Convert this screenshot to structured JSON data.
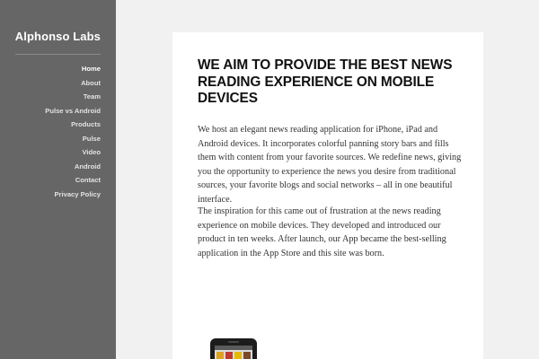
{
  "site": {
    "title": "Alphonso Labs"
  },
  "nav": {
    "items": [
      {
        "label": "Home",
        "active": true
      },
      {
        "label": "About",
        "active": false
      },
      {
        "label": "Team",
        "active": false
      },
      {
        "label": "Pulse vs Android",
        "active": false
      },
      {
        "label": "Products",
        "active": false
      },
      {
        "label": "Pulse",
        "active": false
      },
      {
        "label": "Video",
        "active": false
      },
      {
        "label": "Android",
        "active": false
      },
      {
        "label": "Contact",
        "active": false
      },
      {
        "label": "Privacy Policy",
        "active": false
      }
    ]
  },
  "main": {
    "headline": "WE AIM TO PROVIDE THE BEST NEWS READING EXPERIENCE ON MOBILE DEVICES",
    "paragraphs": [
      "We host an elegant news reading application for iPhone, iPad and Android devices. It incorporates colorful panning story bars and fills them with content from your favorite sources. We redefine news, giving you the opportunity to experience the news you desire from traditional sources, your favorite blogs and social networks – all in one beautiful interface.",
      "The inspiration for this came out of frustration at the news reading experience on mobile devices. They developed and introduced our product in ten weeks. After launch, our App became the best-selling application in the App Store and this site was born."
    ]
  },
  "colors": {
    "sidebar_bg": "#666666",
    "page_bg": "#f1f1f1",
    "content_bg": "#ffffff",
    "tile_colors": [
      "#e0a020",
      "#c0392b",
      "#e6b800",
      "#7a4a2a"
    ]
  }
}
